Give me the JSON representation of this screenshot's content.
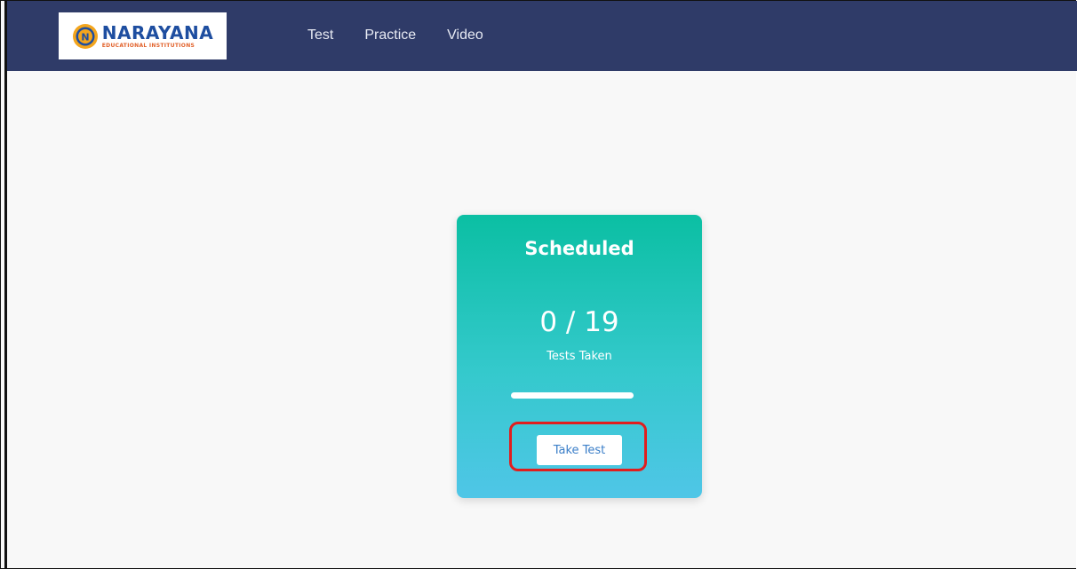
{
  "header": {
    "logo": {
      "name": "NARAYANA",
      "subtitle": "EDUCATIONAL INSTITUTIONS",
      "emblem_icon": "narayana-emblem-icon"
    },
    "nav": [
      {
        "label": "Test"
      },
      {
        "label": "Practice"
      },
      {
        "label": "Video"
      }
    ]
  },
  "card": {
    "title": "Scheduled",
    "count": "0 / 19",
    "taken": 0,
    "total": 19,
    "caption": "Tests Taken",
    "button_label": "Take Test"
  },
  "colors": {
    "navbar": "#2f3b68",
    "card_gradient_top": "#0bbfa3",
    "card_gradient_bottom": "#4fc6e7",
    "highlight": "#e01e1e",
    "button_text": "#3a7ec8"
  }
}
